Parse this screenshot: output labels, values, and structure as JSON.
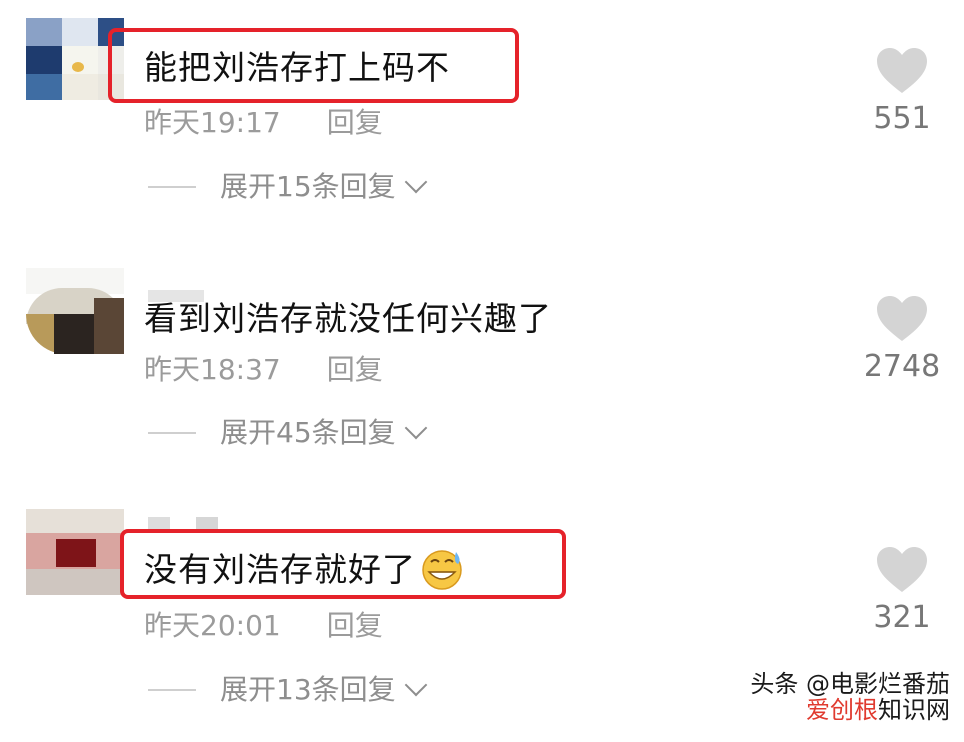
{
  "comments": [
    {
      "text": "能把刘浩存打上码不",
      "time": "昨天19:17",
      "reply": "回复",
      "expand": "展开15条回复",
      "likes": "551",
      "highlighted": true
    },
    {
      "text": "看到刘浩存就没任何兴趣了",
      "time": "昨天18:37",
      "reply": "回复",
      "expand": "展开45条回复",
      "likes": "2748",
      "highlighted": false
    },
    {
      "text": "没有刘浩存就好了",
      "time": "昨天20:01",
      "reply": "回复",
      "expand": "展开13条回复",
      "likes": "321",
      "highlighted": true
    }
  ],
  "watermark": {
    "line1": "头条 @电影烂番茄",
    "line2_red": "爱创根",
    "line2_black": "知识网"
  },
  "colors": {
    "highlight": "#e5222a",
    "meta": "#9b9b9b",
    "heart": "#d4d4d4"
  },
  "icons": {
    "like": "heart-icon",
    "expand": "chevron-down-icon",
    "emoji": "grinning-sweat-emoji"
  }
}
